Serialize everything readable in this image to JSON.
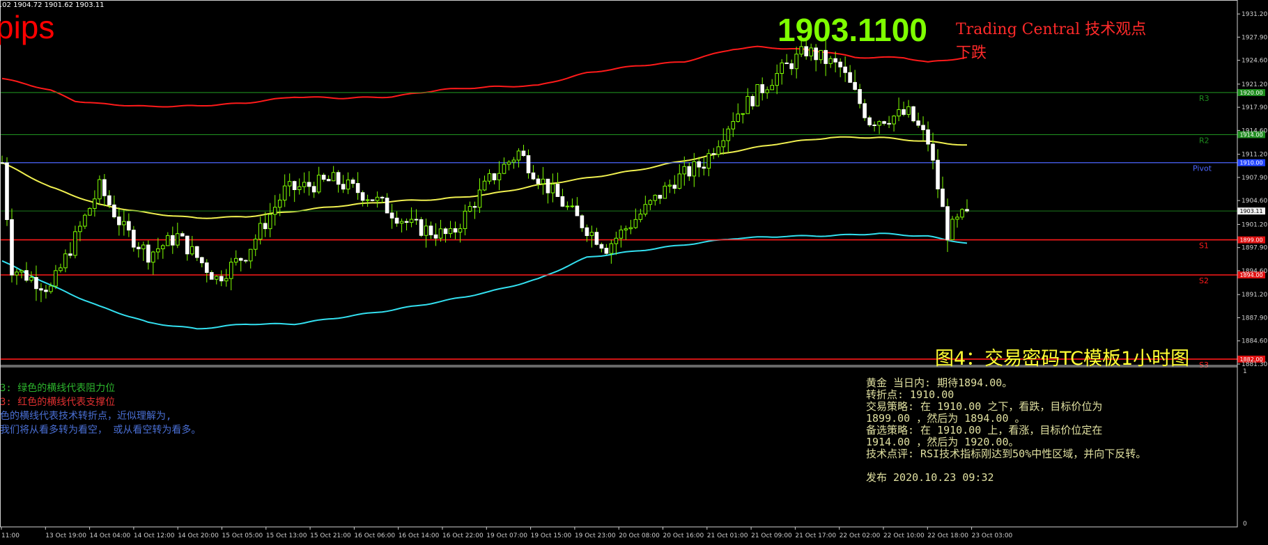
{
  "header": {
    "ohlc": ".02 1904.72 1901.62 1903.11",
    "pips_label": "pips",
    "big_price": "1903.1100",
    "tc_title": "Trading Central 技术观点",
    "tc_view": "下跌",
    "figure_title": "图4：交易密码TC模板1小时图"
  },
  "legend": [
    "3: 绿色的横线代表阻力位",
    "3: 红色的横线代表支撑位",
    "色的横线代表技术转折点，近似理解为,",
    "我们将从看多转为看空， 或从看空转为看多。"
  ],
  "analysis_panel": [
    "黄金 当日内: 期待1894.00。",
    "转折点: 1910.00",
    "交易策略: 在 1910.00 之下，看跌，目标价位为",
    "1899.00 ，然后为 1894.00 。",
    "备选策略: 在 1910.00 上，看涨，目标价位定在",
    "1914.00 ，然后为 1920.00。",
    "技术点评: RSI技术指标刚达到50%中性区域，并向下反转。",
    "",
    "发布 2020.10.23 09:32"
  ],
  "lower_panel": {
    "scale_top": "1",
    "scale_bottom": "0"
  },
  "colors": {
    "background": "#000000",
    "resistance": "#1e8c1e",
    "support": "#ff1a1a",
    "pivot": "#4d66ff",
    "upper_band": "#ff1a1a",
    "lower_band": "#33e0f0",
    "mid_band": "#f0f050",
    "candle": "#7fff00",
    "current_line": "#1e7a1e",
    "r_tag_fill": "#1e8c1e",
    "s_tag_fill": "#e01010",
    "pivot_tag_fill": "#2244ff",
    "price_tag_fill": "#f0f0f0"
  },
  "chart_data": {
    "type": "candlestick",
    "timeframe": "H1",
    "ylim": [
      1881.3,
      1932.2
    ],
    "y_ticks": [
      "1931.20",
      "1927.90",
      "1924.60",
      "1921.20",
      "1917.90",
      "1914.60",
      "1911.20",
      "1907.90",
      "1904.60",
      "1901.20",
      "1897.90",
      "1894.60",
      "1891.20",
      "1887.90",
      "1884.60",
      "1881.30"
    ],
    "x_ticks": [
      "11:00",
      "13 Oct 19:00",
      "14 Oct 04:00",
      "14 Oct 12:00",
      "14 Oct 20:00",
      "15 Oct 05:00",
      "15 Oct 13:00",
      "15 Oct 21:00",
      "16 Oct 06:00",
      "16 Oct 14:00",
      "16 Oct 22:00",
      "19 Oct 07:00",
      "19 Oct 15:00",
      "19 Oct 23:00",
      "20 Oct 08:00",
      "20 Oct 16:00",
      "21 Oct 01:00",
      "21 Oct 09:00",
      "21 Oct 17:00",
      "22 Oct 02:00",
      "22 Oct 10:00",
      "22 Oct 18:00",
      "23 Oct 03:00"
    ],
    "current_price": 1903.11,
    "levels": [
      {
        "name": "R3",
        "value": 1920.0,
        "tag": "1920.00",
        "kind": "resistance"
      },
      {
        "name": "R2",
        "value": 1914.0,
        "tag": "1914.00",
        "kind": "resistance"
      },
      {
        "name": "Pivot",
        "value": 1910.0,
        "tag": "1910.00",
        "kind": "pivot"
      },
      {
        "name": "S1",
        "value": 1899.0,
        "tag": "1899.00",
        "kind": "support"
      },
      {
        "name": "S2",
        "value": 1894.0,
        "tag": "1894.00",
        "kind": "support"
      },
      {
        "name": "S3",
        "value": 1882.0,
        "tag": "1882.00",
        "kind": "support"
      }
    ],
    "series": [
      {
        "name": "upper",
        "points": [
          [
            0,
            1922.0
          ],
          [
            5,
            1921.2
          ],
          [
            10,
            1920.3
          ],
          [
            15,
            1918.8
          ],
          [
            20,
            1918.4
          ],
          [
            30,
            1918.0
          ],
          [
            40,
            1918.1
          ],
          [
            50,
            1918.5
          ],
          [
            60,
            1919.4
          ],
          [
            70,
            1919.2
          ],
          [
            80,
            1919.4
          ],
          [
            90,
            1920.4
          ],
          [
            100,
            1920.8
          ],
          [
            110,
            1921.0
          ],
          [
            120,
            1922.8
          ],
          [
            130,
            1923.8
          ],
          [
            140,
            1924.4
          ],
          [
            145,
            1925.3
          ],
          [
            150,
            1926.2
          ],
          [
            155,
            1926.5
          ],
          [
            160,
            1926.3
          ],
          [
            165,
            1926.1
          ],
          [
            170,
            1925.7
          ],
          [
            175,
            1925.0
          ],
          [
            180,
            1925.0
          ],
          [
            185,
            1925.0
          ],
          [
            190,
            1924.3
          ],
          [
            198,
            1925.0
          ]
        ]
      },
      {
        "name": "middle",
        "points": [
          [
            0,
            1910.0
          ],
          [
            10,
            1906.5
          ],
          [
            20,
            1904.0
          ],
          [
            30,
            1902.8
          ],
          [
            40,
            1902.1
          ],
          [
            50,
            1902.3
          ],
          [
            60,
            1903.1
          ],
          [
            70,
            1903.9
          ],
          [
            80,
            1904.5
          ],
          [
            90,
            1904.8
          ],
          [
            100,
            1905.5
          ],
          [
            110,
            1906.8
          ],
          [
            120,
            1907.8
          ],
          [
            130,
            1908.9
          ],
          [
            140,
            1910.3
          ],
          [
            150,
            1911.6
          ],
          [
            160,
            1912.8
          ],
          [
            170,
            1913.6
          ],
          [
            180,
            1913.6
          ],
          [
            190,
            1913.0
          ],
          [
            198,
            1912.5
          ]
        ]
      },
      {
        "name": "lower",
        "points": [
          [
            0,
            1896.0
          ],
          [
            10,
            1892.5
          ],
          [
            20,
            1889.5
          ],
          [
            30,
            1887.2
          ],
          [
            40,
            1886.3
          ],
          [
            50,
            1887.0
          ],
          [
            60,
            1887.0
          ],
          [
            70,
            1888.0
          ],
          [
            80,
            1889.0
          ],
          [
            90,
            1890.2
          ],
          [
            100,
            1891.6
          ],
          [
            110,
            1893.4
          ],
          [
            120,
            1896.5
          ],
          [
            130,
            1897.4
          ],
          [
            140,
            1898.3
          ],
          [
            150,
            1899.2
          ],
          [
            160,
            1899.5
          ],
          [
            170,
            1899.6
          ],
          [
            180,
            1899.9
          ],
          [
            190,
            1899.5
          ],
          [
            198,
            1898.5
          ]
        ]
      }
    ],
    "key_closes": [
      [
        0,
        1910.0
      ],
      [
        2,
        1895.0
      ],
      [
        10,
        1892.0
      ],
      [
        20,
        1906.5
      ],
      [
        25,
        1900.5
      ],
      [
        30,
        1897.0
      ],
      [
        36,
        1899.5
      ],
      [
        44,
        1893.5
      ],
      [
        50,
        1897.0
      ],
      [
        58,
        1906.0
      ],
      [
        68,
        1907.5
      ],
      [
        76,
        1905.0
      ],
      [
        84,
        1901.0
      ],
      [
        92,
        1899.5
      ],
      [
        100,
        1907.5
      ],
      [
        106,
        1911.5
      ],
      [
        110,
        1908.0
      ],
      [
        118,
        1902.0
      ],
      [
        124,
        1898.0
      ],
      [
        130,
        1902.0
      ],
      [
        138,
        1907.5
      ],
      [
        144,
        1910.0
      ],
      [
        150,
        1916.5
      ],
      [
        158,
        1922.0
      ],
      [
        165,
        1926.0
      ],
      [
        172,
        1923.5
      ],
      [
        178,
        1916.0
      ],
      [
        186,
        1917.0
      ],
      [
        190,
        1913.0
      ],
      [
        194,
        1900.0
      ],
      [
        198,
        1903.11
      ]
    ]
  }
}
